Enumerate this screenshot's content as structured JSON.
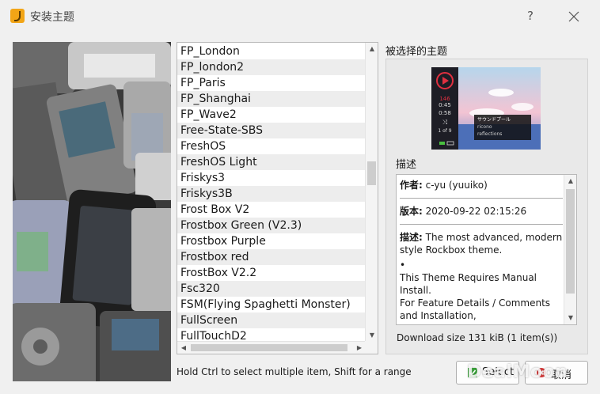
{
  "window": {
    "title": "安装主题",
    "help_label": "?"
  },
  "theme_list": {
    "items": [
      "FP_London",
      "FP_london2",
      "FP_Paris",
      "FP_Shanghai",
      "FP_Wave2",
      "Free-State-SBS",
      "FreshOS",
      "FreshOS Light",
      "Friskys3",
      "Friskys3B",
      "Frost Box V2",
      "Frostbox Green (V2.3)",
      "Frostbox Purple",
      "Frostbox red",
      "FrostBox V2.2",
      "Fsc320",
      "FSM(Flying Spaghetti Monster)",
      "FullScreen",
      "FullTouchD2"
    ]
  },
  "selected_panel": {
    "label": "被选择的主题",
    "preview": {
      "counter_top": "146",
      "time": "0:45",
      "counter_bottom": "0:58",
      "track_index": "1 of 9",
      "track_title": "サウンドプール",
      "artist": "ricono",
      "album": "reflections"
    },
    "description_label": "描述",
    "description": {
      "author_label": "作者:",
      "author": "c-yu (yuuiko)",
      "version_label": "版本:",
      "version": "2020-09-22 02:15:26",
      "desc_label": "描述:",
      "desc_text": "The most advanced, modern style Rockbox theme.",
      "bullet": "•",
      "line1": "This Theme Requires Manual Install.",
      "line2": "For Feature Details / Comments and Installation,"
    },
    "download_size": "Download size 131 kiB (1 item(s))"
  },
  "hint": "Hold Ctrl to select multiple item, Shift for a range",
  "buttons": {
    "select_label": "Select",
    "cancel_label": "取消"
  },
  "watermark": "DealMoon",
  "colors": {
    "accent": "#f2a516",
    "preview_red": "#e03040"
  },
  "icons": {
    "app": "rockbox-logo-icon",
    "close": "close-icon",
    "select": "check-icon",
    "cancel": "cancel-icon"
  }
}
